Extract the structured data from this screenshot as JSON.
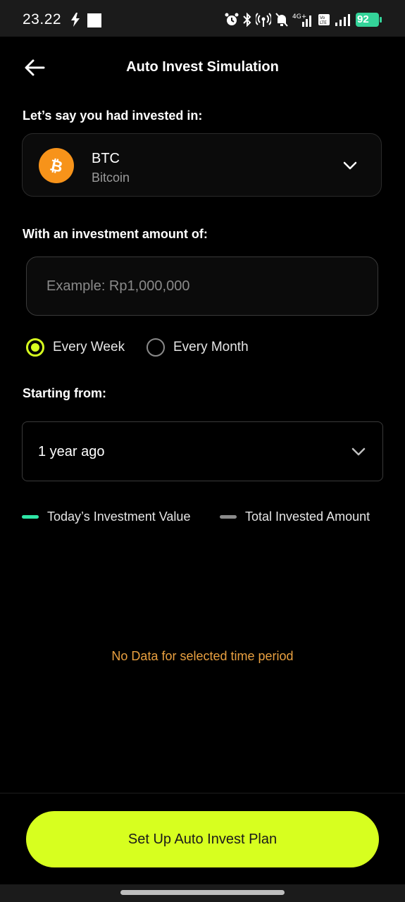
{
  "status_bar": {
    "time": "23.22",
    "battery_level": "92",
    "network_label": "4G+"
  },
  "header": {
    "title": "Auto Invest Simulation",
    "back_icon": "arrow-left-icon"
  },
  "asset_section": {
    "label": "Let’s say you had invested in:",
    "symbol": "BTC",
    "name": "Bitcoin",
    "coin_color": "#f7931a"
  },
  "amount_section": {
    "label": "With an investment amount of:",
    "value": "",
    "placeholder": "Example: Rp1,000,000"
  },
  "frequency": {
    "options": [
      {
        "label": "Every Week",
        "selected": true
      },
      {
        "label": "Every Month",
        "selected": false
      }
    ]
  },
  "start_section": {
    "label": "Starting from:",
    "selected": "1 year ago"
  },
  "legend": [
    {
      "label": "Today’s Investment Value",
      "color": "#2ee6a6"
    },
    {
      "label": "Total Invested Amount",
      "color": "#8a8a8a"
    }
  ],
  "chart": {
    "empty_message": "No Data for selected time period"
  },
  "cta": {
    "label": "Set Up Auto Invest Plan"
  },
  "colors": {
    "accent": "#d7ff1f",
    "warning_text": "#e9a040",
    "background": "#000000"
  }
}
